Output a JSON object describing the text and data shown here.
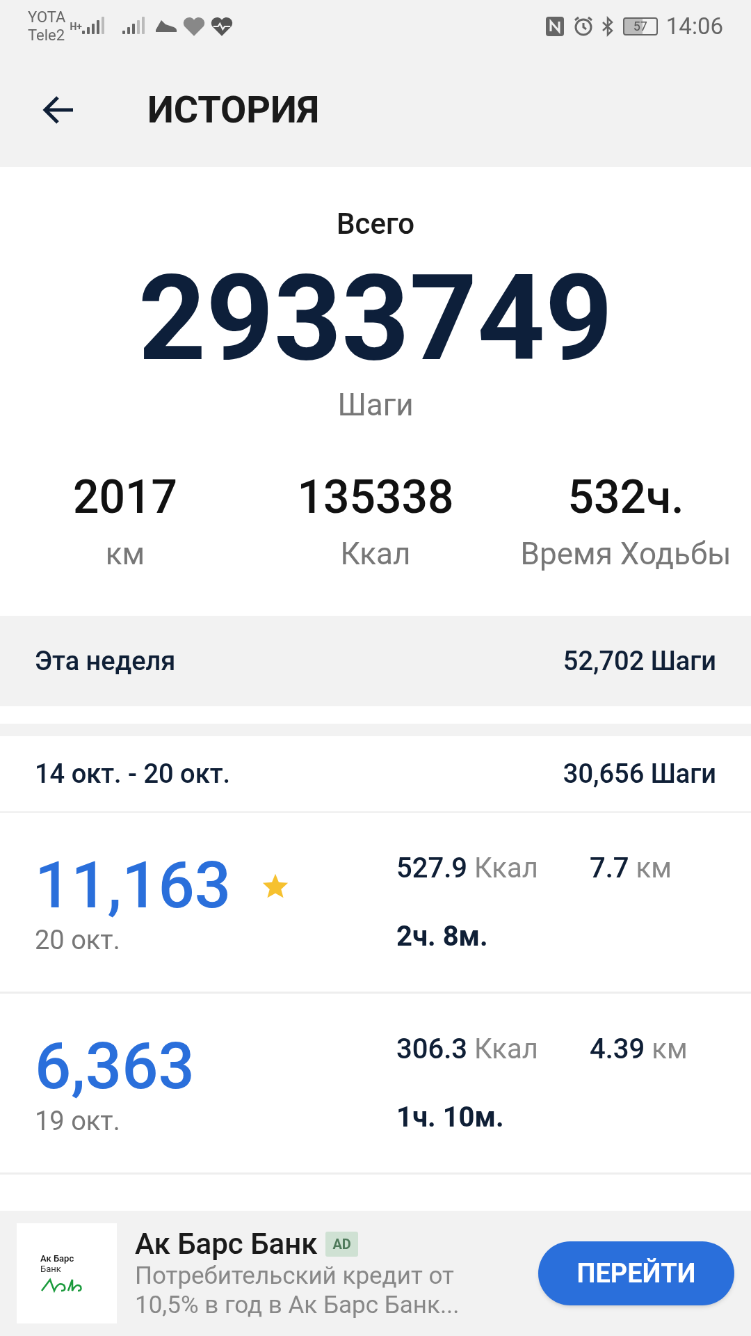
{
  "status_bar": {
    "carriers": [
      "YOTA",
      "Tele2"
    ],
    "network": "H+",
    "battery": "57",
    "time": "14:06"
  },
  "header": {
    "title": "ИСТОРИЯ"
  },
  "total": {
    "label": "Всего",
    "value": "2933749",
    "unit": "Шаги"
  },
  "stats": [
    {
      "value": "2017",
      "label": "км"
    },
    {
      "value": "135338",
      "label": "Ккал"
    },
    {
      "value": "532ч.",
      "label": "Время Ходьбы"
    }
  ],
  "this_week": {
    "label": "Эта неделя",
    "steps": "52,702 Шаги"
  },
  "week": {
    "range": "14 окт. - 20 окт.",
    "steps": "30,656 Шаги"
  },
  "days": [
    {
      "steps": "11,163",
      "date": "20 окт.",
      "goal_reached": true,
      "kcal": "527.9",
      "kcal_unit": "Ккал",
      "distance": "7.7",
      "distance_unit": "км",
      "duration": "2ч. 8м."
    },
    {
      "steps": "6,363",
      "date": "19 окт.",
      "goal_reached": false,
      "kcal": "306.3",
      "kcal_unit": "Ккал",
      "distance": "4.39",
      "distance_unit": "км",
      "duration": "1ч. 10м."
    }
  ],
  "ad": {
    "logo_lines": [
      "Ак Барс",
      "Банк"
    ],
    "title": "Ак Барс Банк",
    "badge": "AD",
    "text": "Потребительский кредит от 10,5% в год в Ак Барс Банк...",
    "button": "ПЕРЕЙТИ"
  }
}
